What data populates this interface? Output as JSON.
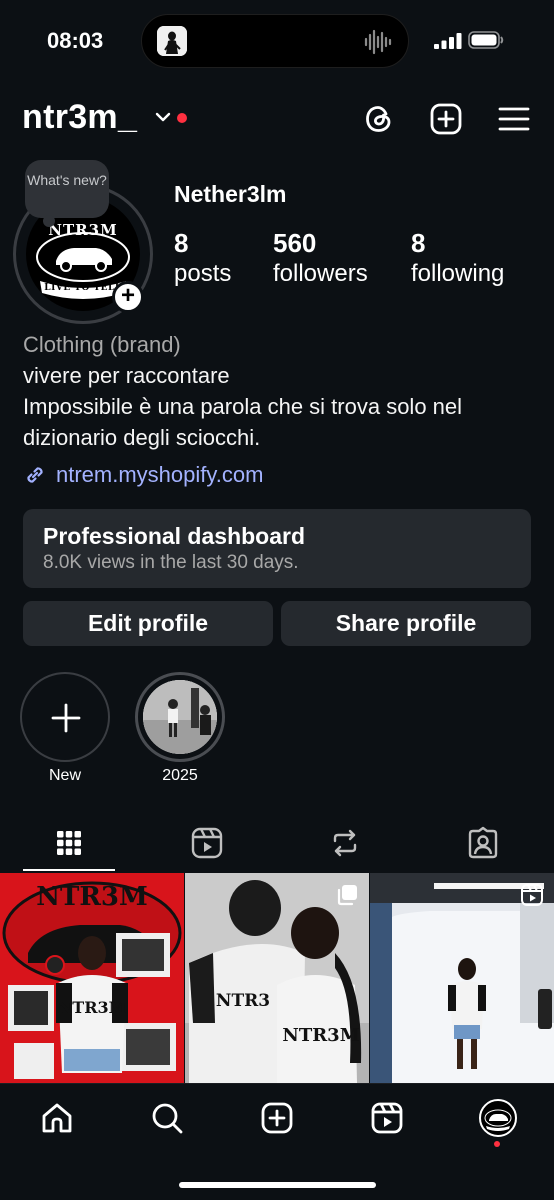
{
  "status_bar": {
    "time": "08:03",
    "icons": [
      "dynamic-island",
      "audio-waveform-icon",
      "signal-icon",
      "battery-icon"
    ]
  },
  "header": {
    "username": "ntr3m_",
    "icons": [
      "chevron-down-icon",
      "threads-icon",
      "create-icon",
      "menu-icon"
    ],
    "notification_dot_color": "#ff3040"
  },
  "profile": {
    "note": "What's new?",
    "avatar_logo": "NTR3M",
    "avatar_tagline": "LIVE TO TELL",
    "display_name": "Nether3lm",
    "stats": [
      {
        "value": "8",
        "label": "posts"
      },
      {
        "value": "560",
        "label": "followers"
      },
      {
        "value": "8",
        "label": "following"
      }
    ],
    "category": "Clothing (brand)",
    "bio_lines": [
      "vivere per raccontare",
      "Impossibile è una parola che si trova solo nel",
      "dizionario degli sciocchi."
    ],
    "link": "ntrem.myshopify.com",
    "link_color": "#a3b2ff"
  },
  "dashboard": {
    "title": "Professional dashboard",
    "subtitle": "8.0K views in the last 30 days."
  },
  "buttons": {
    "edit": "Edit profile",
    "share": "Share profile"
  },
  "highlights": [
    {
      "label": "New"
    },
    {
      "label": "2025"
    }
  ],
  "tabs": [
    "grid-icon",
    "reels-icon",
    "reposts-icon",
    "tagged-icon"
  ],
  "grid_posts": [
    {
      "type": "image"
    },
    {
      "type": "carousel"
    },
    {
      "type": "reel"
    }
  ],
  "bottom_nav": [
    "home-icon",
    "search-icon",
    "create-icon",
    "reels-icon",
    "profile-avatar"
  ],
  "colors": {
    "background": "#0c1014",
    "card": "#25292e",
    "accent_red": "#ff3040"
  }
}
